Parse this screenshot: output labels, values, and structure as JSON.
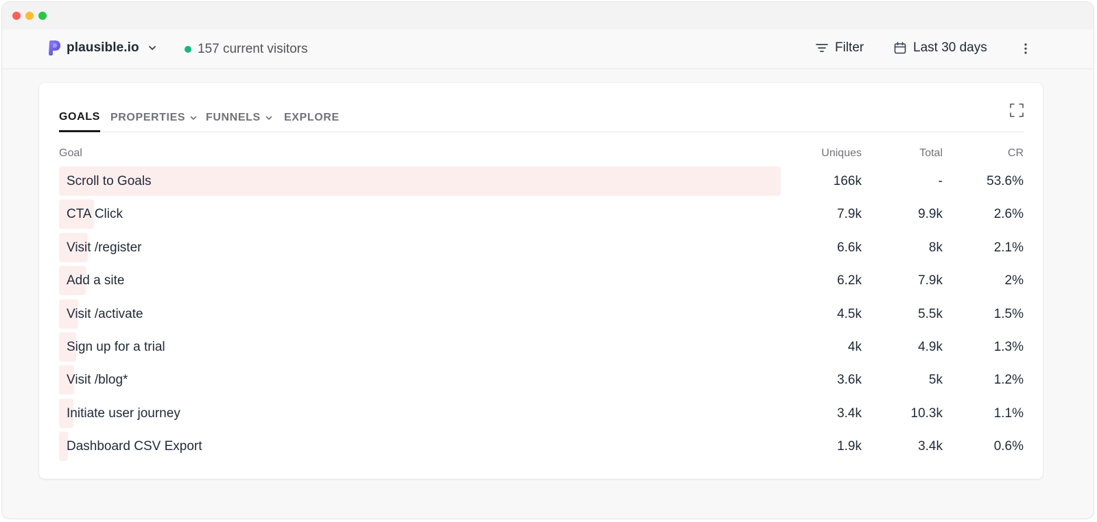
{
  "header": {
    "site_name": "plausible.io",
    "visitors_text": "157 current visitors",
    "filter_label": "Filter",
    "period_label": "Last 30 days"
  },
  "tabs": [
    {
      "label": "GOALS",
      "active": true
    },
    {
      "label": "PROPERTIES"
    },
    {
      "label": "FUNNELS"
    },
    {
      "label": "EXPLORE"
    }
  ],
  "table": {
    "headers": {
      "goal": "Goal",
      "uniques": "Uniques",
      "total": "Total",
      "cr": "CR"
    },
    "rows": [
      {
        "goal": "Scroll to Goals",
        "uniques": "166k",
        "total": "-",
        "cr": "53.6%",
        "bar": 0.748
      },
      {
        "goal": "CTA Click",
        "uniques": "7.9k",
        "total": "9.9k",
        "cr": "2.6%",
        "bar": 0.036
      },
      {
        "goal": "Visit /register",
        "uniques": "6.6k",
        "total": "8k",
        "cr": "2.1%",
        "bar": 0.03
      },
      {
        "goal": "Add a site",
        "uniques": "6.2k",
        "total": "7.9k",
        "cr": "2%",
        "bar": 0.028
      },
      {
        "goal": "Visit /activate",
        "uniques": "4.5k",
        "total": "5.5k",
        "cr": "1.5%",
        "bar": 0.02
      },
      {
        "goal": "Sign up for a trial",
        "uniques": "4k",
        "total": "4.9k",
        "cr": "1.3%",
        "bar": 0.018
      },
      {
        "goal": "Visit /blog*",
        "uniques": "3.6k",
        "total": "5k",
        "cr": "1.2%",
        "bar": 0.016
      },
      {
        "goal": "Initiate user journey",
        "uniques": "3.4k",
        "total": "10.3k",
        "cr": "1.1%",
        "bar": 0.015
      },
      {
        "goal": "Dashboard CSV Export",
        "uniques": "1.9k",
        "total": "3.4k",
        "cr": "0.6%",
        "bar": 0.009
      }
    ]
  },
  "colors": {
    "bar": "#fdeeee",
    "live_dot": "#10b981",
    "logo": "#5850ec"
  }
}
